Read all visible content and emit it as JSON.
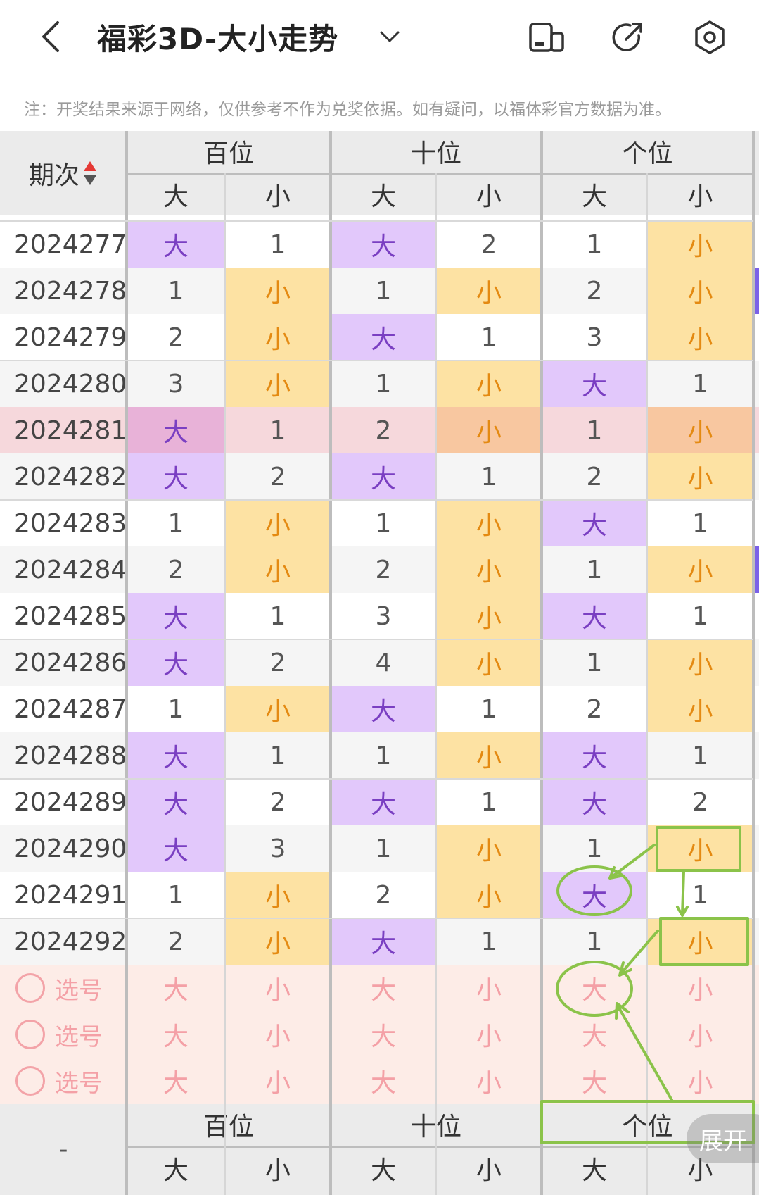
{
  "header": {
    "title": "福彩3D-大小走势",
    "icons": [
      "back-arrow-icon",
      "chevron-down-icon",
      "device-toggle-icon",
      "share-icon",
      "settings-icon"
    ]
  },
  "note": "注：开奖结果来源于网络，仅供参考不作为兑奖依据。如有疑问，以福体彩官方数据为准。",
  "table": {
    "period_header": "期次",
    "groups": [
      "百位",
      "十位",
      "个位"
    ],
    "sub": [
      "大",
      "小"
    ],
    "rows": [
      {
        "period": "2024277",
        "cells": [
          "大",
          "1",
          "大",
          "2",
          "1",
          "小"
        ]
      },
      {
        "period": "2024278",
        "cells": [
          "1",
          "小",
          "1",
          "小",
          "2",
          "小"
        ]
      },
      {
        "period": "2024279",
        "cells": [
          "2",
          "小",
          "大",
          "1",
          "3",
          "小"
        ]
      },
      {
        "period": "2024280",
        "cells": [
          "3",
          "小",
          "1",
          "小",
          "大",
          "1"
        ]
      },
      {
        "period": "2024281",
        "cells": [
          "大",
          "1",
          "2",
          "小",
          "1",
          "小"
        ],
        "highlight": true
      },
      {
        "period": "2024282",
        "cells": [
          "大",
          "2",
          "大",
          "1",
          "2",
          "小"
        ]
      },
      {
        "period": "2024283",
        "cells": [
          "1",
          "小",
          "1",
          "小",
          "大",
          "1"
        ]
      },
      {
        "period": "2024284",
        "cells": [
          "2",
          "小",
          "2",
          "小",
          "1",
          "小"
        ]
      },
      {
        "period": "2024285",
        "cells": [
          "大",
          "1",
          "3",
          "小",
          "大",
          "1"
        ]
      },
      {
        "period": "2024286",
        "cells": [
          "大",
          "2",
          "4",
          "小",
          "1",
          "小"
        ]
      },
      {
        "period": "2024287",
        "cells": [
          "1",
          "小",
          "大",
          "1",
          "2",
          "小"
        ]
      },
      {
        "period": "2024288",
        "cells": [
          "大",
          "1",
          "1",
          "小",
          "大",
          "1"
        ]
      },
      {
        "period": "2024289",
        "cells": [
          "大",
          "2",
          "大",
          "1",
          "大",
          "2"
        ]
      },
      {
        "period": "2024290",
        "cells": [
          "大",
          "3",
          "1",
          "小",
          "1",
          "小"
        ]
      },
      {
        "period": "2024291",
        "cells": [
          "1",
          "小",
          "2",
          "小",
          "大",
          "1"
        ]
      },
      {
        "period": "2024292",
        "cells": [
          "2",
          "小",
          "大",
          "1",
          "1",
          "小"
        ]
      }
    ],
    "pick_label": "选号",
    "pick_rows": 3,
    "footer_period": "-"
  },
  "expand_label": "展开",
  "colors": {
    "big_bg": "#e2c8fb",
    "big_text": "#7a3fc2",
    "small_bg": "#fde2a3",
    "small_text": "#e48a12",
    "highlight_row": "#f6d8dc",
    "pick_bg": "#fdece7",
    "annotation_green": "#8bc34a"
  }
}
